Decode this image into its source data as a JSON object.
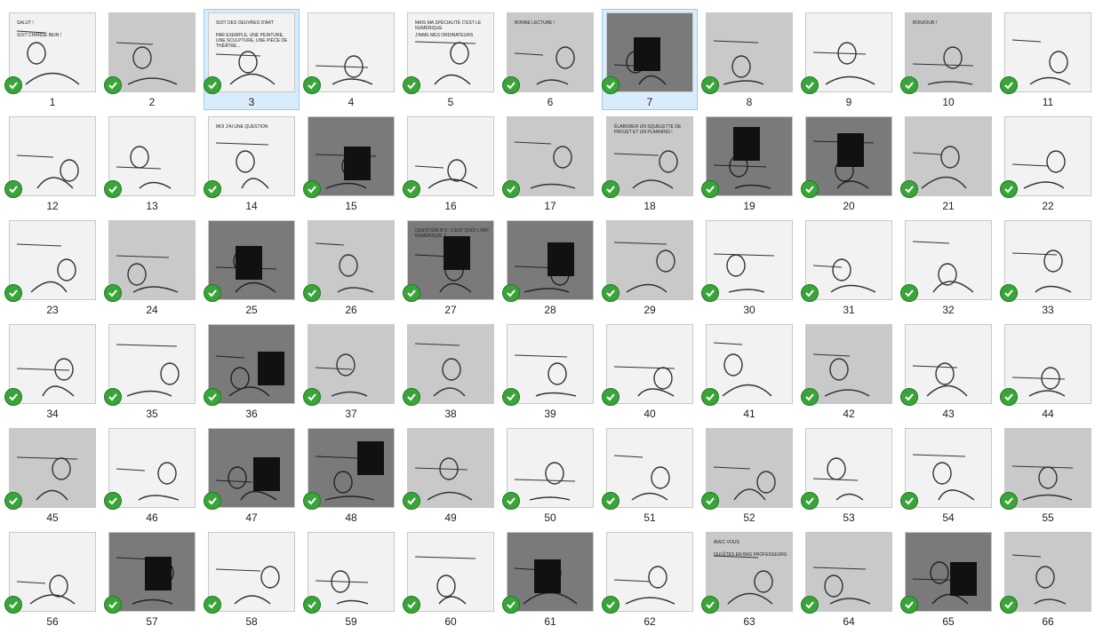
{
  "view": {
    "selected": [
      "3",
      "7"
    ],
    "status_icon": "green-check-icon",
    "items": [
      {
        "label": "1",
        "tone": "light",
        "texts": [
          "SALUT !",
          "SOIT CHANGÉ BEIN !"
        ]
      },
      {
        "label": "2",
        "tone": "mid",
        "texts": []
      },
      {
        "label": "3",
        "tone": "light",
        "texts": [
          "SOIT DES OEUVRES D'ART",
          "PAR EXEMPLE, UNE PEINTURE, UNE SCULPTURE, UNE PIÈCE DE THÉÂTRE..."
        ]
      },
      {
        "label": "4",
        "tone": "light",
        "texts": []
      },
      {
        "label": "5",
        "tone": "light",
        "texts": [
          "MAIS MA SPÉCIALITÉ C'EST LE NUMÉRIQUE",
          "J'AIME MES ORDINATEURS"
        ]
      },
      {
        "label": "6",
        "tone": "mid",
        "texts": [
          "BONNE LECTURE !"
        ]
      },
      {
        "label": "7",
        "tone": "dark",
        "texts": []
      },
      {
        "label": "8",
        "tone": "mid",
        "texts": []
      },
      {
        "label": "9",
        "tone": "light",
        "texts": []
      },
      {
        "label": "10",
        "tone": "mid",
        "texts": [
          "BONJOUR !"
        ]
      },
      {
        "label": "11",
        "tone": "light",
        "texts": []
      },
      {
        "label": "12",
        "tone": "light",
        "texts": []
      },
      {
        "label": "13",
        "tone": "light",
        "texts": []
      },
      {
        "label": "14",
        "tone": "light",
        "texts": [
          "MOI J'AI UNE QUESTION"
        ]
      },
      {
        "label": "15",
        "tone": "dark",
        "texts": []
      },
      {
        "label": "16",
        "tone": "light",
        "texts": []
      },
      {
        "label": "17",
        "tone": "mid",
        "texts": []
      },
      {
        "label": "18",
        "tone": "mid",
        "texts": [
          "ÉLABORER UN SQUELETTE DE PROJET ET UN PLANNING !"
        ]
      },
      {
        "label": "19",
        "tone": "dark",
        "texts": []
      },
      {
        "label": "20",
        "tone": "dark",
        "texts": []
      },
      {
        "label": "21",
        "tone": "mid",
        "texts": []
      },
      {
        "label": "22",
        "tone": "light",
        "texts": []
      },
      {
        "label": "23",
        "tone": "light",
        "texts": []
      },
      {
        "label": "24",
        "tone": "mid",
        "texts": []
      },
      {
        "label": "25",
        "tone": "dark",
        "texts": []
      },
      {
        "label": "26",
        "tone": "mid",
        "texts": []
      },
      {
        "label": "27",
        "tone": "dark",
        "texts": [
          "QUESTION N°3 : C'EST QUOI L'ART NUMÉRIQUE ?"
        ]
      },
      {
        "label": "28",
        "tone": "dark",
        "texts": []
      },
      {
        "label": "29",
        "tone": "mid",
        "texts": []
      },
      {
        "label": "30",
        "tone": "light",
        "texts": []
      },
      {
        "label": "31",
        "tone": "light",
        "texts": []
      },
      {
        "label": "32",
        "tone": "light",
        "texts": []
      },
      {
        "label": "33",
        "tone": "light",
        "texts": []
      },
      {
        "label": "34",
        "tone": "light",
        "texts": []
      },
      {
        "label": "35",
        "tone": "light",
        "texts": []
      },
      {
        "label": "36",
        "tone": "dark",
        "texts": []
      },
      {
        "label": "37",
        "tone": "mid",
        "texts": []
      },
      {
        "label": "38",
        "tone": "mid",
        "texts": []
      },
      {
        "label": "39",
        "tone": "light",
        "texts": []
      },
      {
        "label": "40",
        "tone": "light",
        "texts": []
      },
      {
        "label": "41",
        "tone": "light",
        "texts": []
      },
      {
        "label": "42",
        "tone": "mid",
        "texts": []
      },
      {
        "label": "43",
        "tone": "light",
        "texts": []
      },
      {
        "label": "44",
        "tone": "light",
        "texts": []
      },
      {
        "label": "45",
        "tone": "mid",
        "texts": []
      },
      {
        "label": "46",
        "tone": "light",
        "texts": []
      },
      {
        "label": "47",
        "tone": "dark",
        "texts": []
      },
      {
        "label": "48",
        "tone": "dark",
        "texts": []
      },
      {
        "label": "49",
        "tone": "mid",
        "texts": []
      },
      {
        "label": "50",
        "tone": "light",
        "texts": []
      },
      {
        "label": "51",
        "tone": "light",
        "texts": []
      },
      {
        "label": "52",
        "tone": "mid",
        "texts": []
      },
      {
        "label": "53",
        "tone": "light",
        "texts": []
      },
      {
        "label": "54",
        "tone": "light",
        "texts": []
      },
      {
        "label": "55",
        "tone": "mid",
        "texts": []
      },
      {
        "label": "56",
        "tone": "light",
        "texts": []
      },
      {
        "label": "57",
        "tone": "dark",
        "texts": []
      },
      {
        "label": "58",
        "tone": "light",
        "texts": []
      },
      {
        "label": "59",
        "tone": "light",
        "texts": []
      },
      {
        "label": "60",
        "tone": "light",
        "texts": []
      },
      {
        "label": "61",
        "tone": "dark",
        "texts": []
      },
      {
        "label": "62",
        "tone": "light",
        "texts": []
      },
      {
        "label": "63",
        "tone": "mid",
        "texts": [
          "AVEC VOUS",
          "QUI ÊTES EN BAS PROFESSEURS"
        ]
      },
      {
        "label": "64",
        "tone": "mid",
        "texts": []
      },
      {
        "label": "65",
        "tone": "dark",
        "texts": []
      },
      {
        "label": "66",
        "tone": "mid",
        "texts": []
      }
    ]
  },
  "colors": {
    "check_green": "#3aa43a",
    "selection": "#d9ecfb",
    "tone_light": "#f2f2f2",
    "tone_mid": "#c9c9c9",
    "tone_dark": "#7a7a7a"
  }
}
